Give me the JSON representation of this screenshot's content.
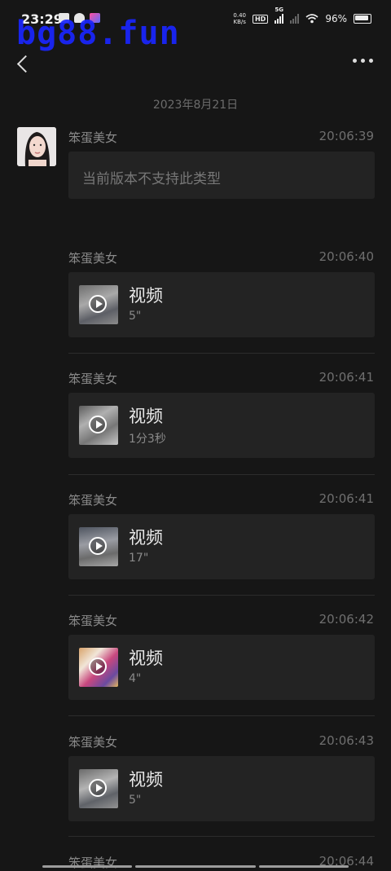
{
  "status": {
    "time": "23:29",
    "net_speed_value": "0.40",
    "net_speed_unit": "KB/s",
    "hd_label": "HD",
    "network_label": "5G",
    "battery_text": "96%",
    "app_icons": [
      "message-icon",
      "weather-icon",
      "app-icon"
    ]
  },
  "watermark": "bg88.fun",
  "nav": {
    "back_icon": "chevron-left-icon",
    "more_icon": "more-dots-icon"
  },
  "date_separator": "2023年8月21日",
  "messages": [
    {
      "sender": "笨蛋美女",
      "time": "20:06:39",
      "type": "text",
      "text": "当前版本不支持此类型"
    },
    {
      "sender": "笨蛋美女",
      "time": "20:06:40",
      "type": "video",
      "title": "视频",
      "duration": "5\""
    },
    {
      "sender": "笨蛋美女",
      "time": "20:06:41",
      "type": "video",
      "title": "视频",
      "duration": "1分3秒"
    },
    {
      "sender": "笨蛋美女",
      "time": "20:06:41",
      "type": "video",
      "title": "视频",
      "duration": "17\""
    },
    {
      "sender": "笨蛋美女",
      "time": "20:06:42",
      "type": "video",
      "title": "视频",
      "duration": "4\""
    },
    {
      "sender": "笨蛋美女",
      "time": "20:06:43",
      "type": "video",
      "title": "视频",
      "duration": "5\""
    },
    {
      "sender": "笨蛋美女",
      "time": "20:06:44",
      "type": "partial"
    }
  ],
  "colors": {
    "background": "#161616",
    "bubble": "#232323",
    "watermark": "#1a26ff"
  }
}
